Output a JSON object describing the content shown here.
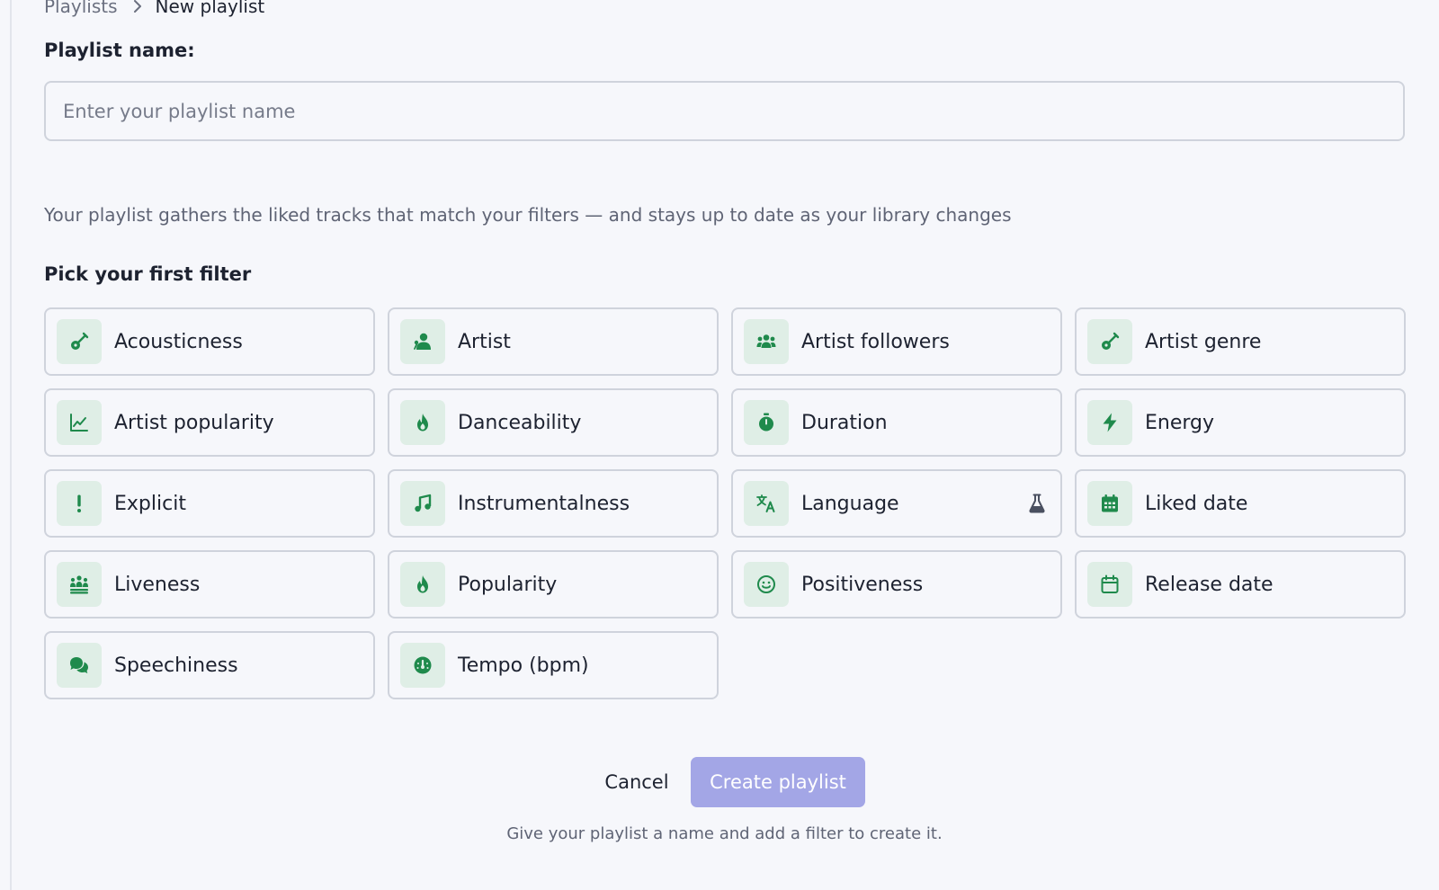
{
  "breadcrumb": {
    "parent": "Playlists",
    "current": "New playlist"
  },
  "playlist_name": {
    "label": "Playlist name:",
    "value": "",
    "placeholder": "Enter your playlist name"
  },
  "description": "Your playlist gathers the liked tracks that match your filters — and stays up to date as your library changes",
  "filters": {
    "heading": "Pick your first filter",
    "icon_color": "#1f8a4c",
    "icon_bg": "#dfeee6",
    "items": [
      {
        "label": "Acousticness",
        "icon": "guitar-icon"
      },
      {
        "label": "Artist",
        "icon": "user-mic-icon"
      },
      {
        "label": "Artist followers",
        "icon": "users-icon"
      },
      {
        "label": "Artist genre",
        "icon": "guitar-icon"
      },
      {
        "label": "Artist popularity",
        "icon": "line-chart-icon"
      },
      {
        "label": "Danceability",
        "icon": "fire-icon"
      },
      {
        "label": "Duration",
        "icon": "stopwatch-icon"
      },
      {
        "label": "Energy",
        "icon": "bolt-icon"
      },
      {
        "label": "Explicit",
        "icon": "exclamation-icon"
      },
      {
        "label": "Instrumentalness",
        "icon": "music-note-icon"
      },
      {
        "label": "Language",
        "icon": "translate-icon",
        "badge": "flask-icon"
      },
      {
        "label": "Liked date",
        "icon": "calendar-filled-icon"
      },
      {
        "label": "Liveness",
        "icon": "crowd-icon"
      },
      {
        "label": "Popularity",
        "icon": "fire-icon"
      },
      {
        "label": "Positiveness",
        "icon": "smile-icon"
      },
      {
        "label": "Release date",
        "icon": "calendar-outline-icon"
      },
      {
        "label": "Speechiness",
        "icon": "chat-bubbles-icon"
      },
      {
        "label": "Tempo (bpm)",
        "icon": "gauge-icon"
      }
    ]
  },
  "actions": {
    "cancel_label": "Cancel",
    "create_label": "Create playlist",
    "create_color": "#a3a6e6"
  },
  "hint": "Give your playlist a name and add a filter to create it."
}
